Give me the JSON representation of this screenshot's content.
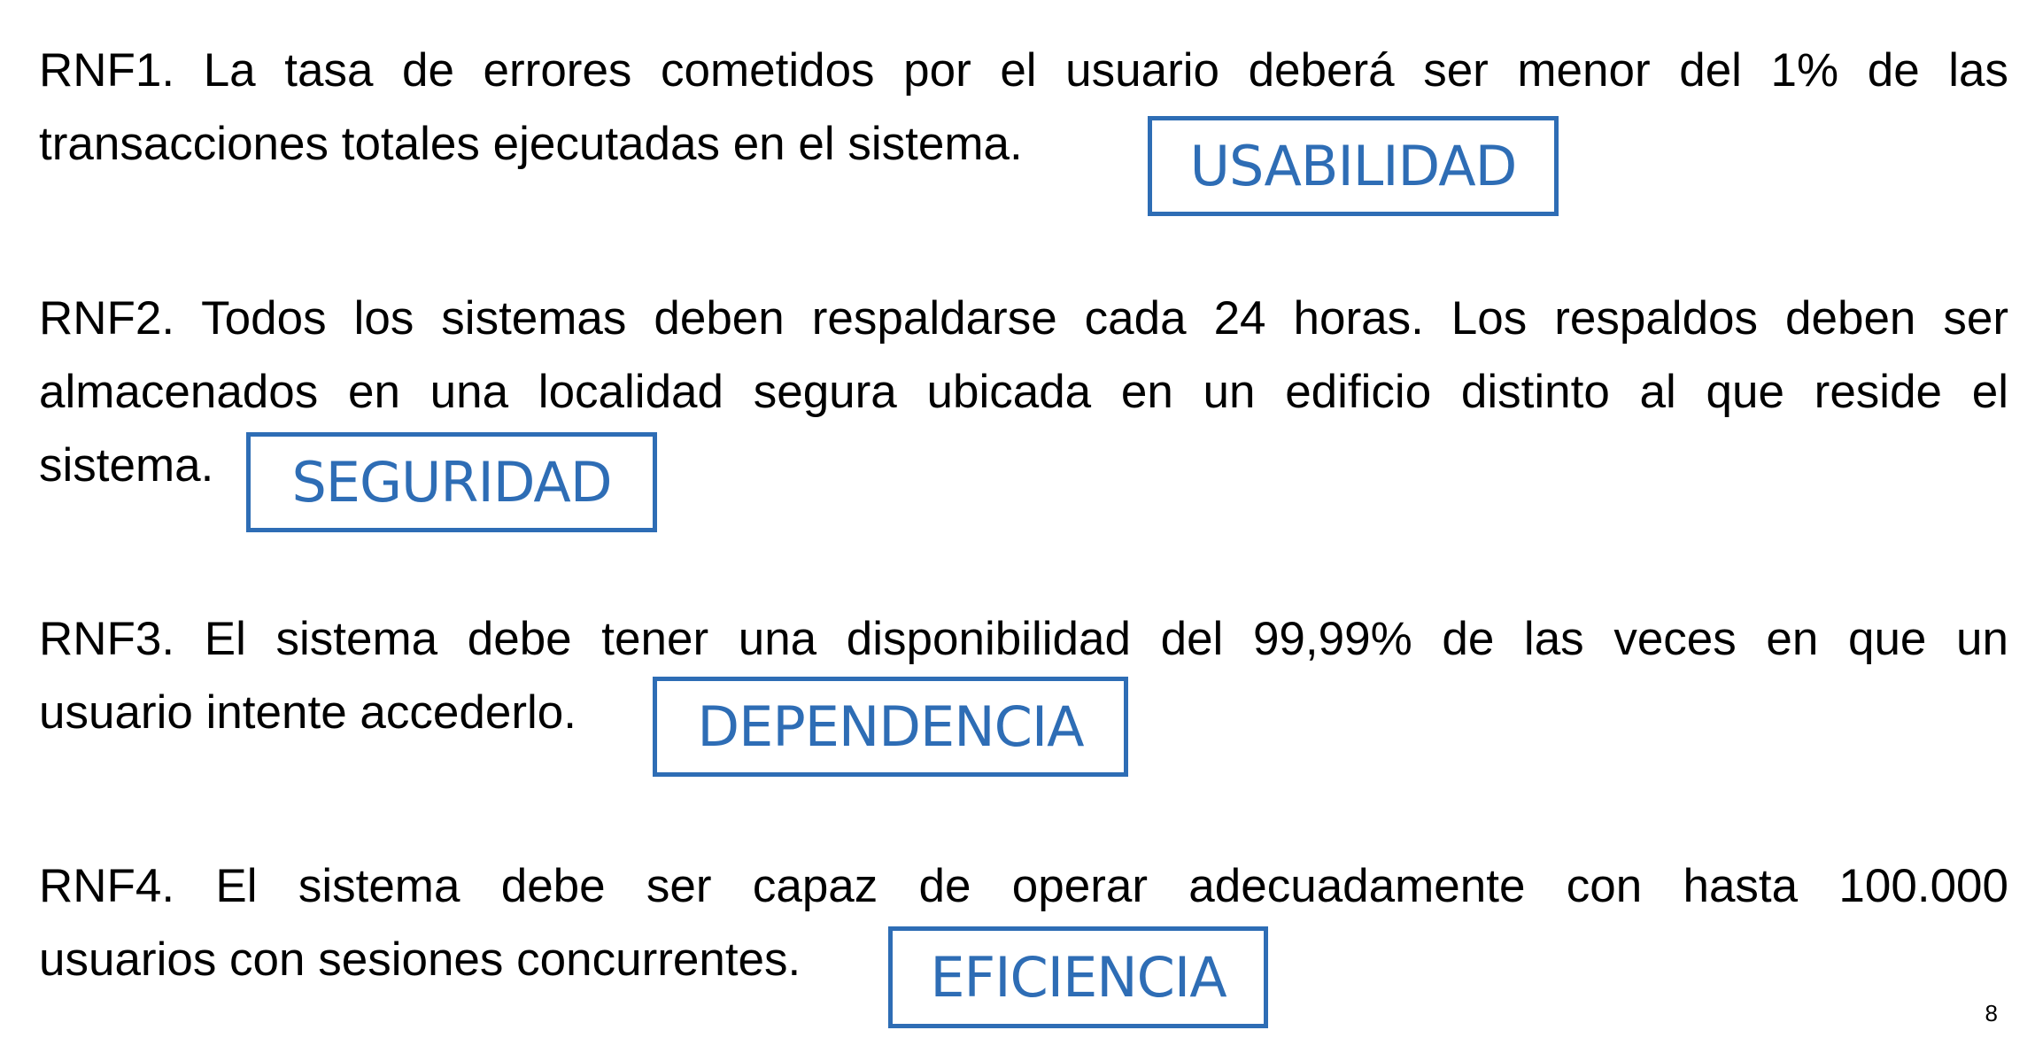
{
  "requirements": [
    {
      "line1": "RNF1. La tasa de errores cometidos por el usuario deberá ser menor del 1% de las",
      "line2": "transacciones totales ejecutadas en el sistema.",
      "category": "USABILIDAD"
    },
    {
      "line1": "RNF2. Todos los sistemas deben respaldarse cada 24 horas. Los respaldos deben ser",
      "line2": "almacenados en una localidad segura ubicada en un edificio distinto al que reside el",
      "line3": "sistema.",
      "category": "SEGURIDAD"
    },
    {
      "line1": "RNF3. El sistema debe tener una disponibilidad del 99,99% de las veces en que un",
      "line2": "usuario intente accederlo.",
      "category": "DEPENDENCIA"
    },
    {
      "line1": "RNF4. El sistema debe ser capaz de operar adecuadamente con hasta 100.000",
      "line2": "usuarios con sesiones concurrentes.",
      "category": "EFICIENCIA"
    }
  ],
  "page_number": "8",
  "colors": {
    "tag": "#2e6db5",
    "text": "#000000"
  }
}
